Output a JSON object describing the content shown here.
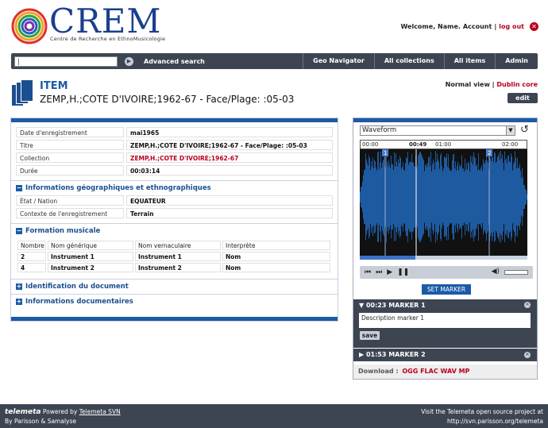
{
  "brand": {
    "name": "CREM",
    "subtitle": "Centre de Recherche en EthnoMusicologie"
  },
  "account": {
    "welcome": "Welcome, Name.",
    "account_label": "Account",
    "separator": "|",
    "logout": "log out"
  },
  "nav": {
    "search_value": "|",
    "advanced": "Advanced search",
    "links": [
      "Geo Navigator",
      "All collections",
      "All items",
      "Admin"
    ]
  },
  "item": {
    "heading": "ITEM",
    "subtitle": "ZEMP,H.;COTE D'IVOIRE;1962-67 - Face/Plage: :05-03",
    "normal_view": "Normal view",
    "view_sep": "|",
    "dublin_core": "Dublin core",
    "edit": "edit"
  },
  "fields": [
    {
      "label": "Date d'enregistrement",
      "value": "mai1965"
    },
    {
      "label": "Titre",
      "value": "ZEMP,H.;COTE D'IVOIRE;1962-67 - Face/Plage: :05-03"
    },
    {
      "label": "Collection",
      "value": "ZEMP,H.;COTE D'IVOIRE;1962-67"
    },
    {
      "label": "Durée",
      "value": "00:03:14"
    }
  ],
  "geo": {
    "title": "Informations géographiques et ethnographiques",
    "rows": [
      {
        "label": "État / Nation",
        "value": "EQUATEUR"
      },
      {
        "label": "Contexte de l'enregistrement",
        "value": "Terrain"
      }
    ]
  },
  "formation": {
    "title": "Formation musicale",
    "headers": [
      "Nombre",
      "Nom générique",
      "Nom vernaculaire",
      "Interprète"
    ],
    "rows": [
      [
        "2",
        "Instrument 1",
        "Instrument 1",
        "Nom"
      ],
      [
        "4",
        "Instrument 2",
        "Instrument 2",
        "Nom"
      ]
    ]
  },
  "collapsed_sections": [
    "Identification du document",
    "Informations documentaires"
  ],
  "player": {
    "view_select": "Waveform",
    "ruler": [
      "00:00",
      "00:49",
      "01:00",
      "02:00"
    ],
    "marker_flags": [
      "1",
      "2"
    ],
    "set_marker": "SET MARKER",
    "markers": [
      {
        "time": "00:23",
        "name": "MARKER 1",
        "description": "Description marker 1",
        "save": "save"
      },
      {
        "time": "01:53",
        "name": "MARKER 2"
      }
    ],
    "download_label": "Download :",
    "formats": "OGG FLAC WAV MP"
  },
  "footer": {
    "logo": "telemeta",
    "powered_prefix": "Powered by",
    "powered_link": "Telemeta SVN",
    "by_line": "By Parisson & Samalyse",
    "visit": "Visit the Telemeta open source project at",
    "url": "http://svn.parisson.org/telemeta"
  },
  "colors": {
    "accent": "#1b5ba6",
    "dark": "#3d4552",
    "link_red": "#b8001e"
  }
}
